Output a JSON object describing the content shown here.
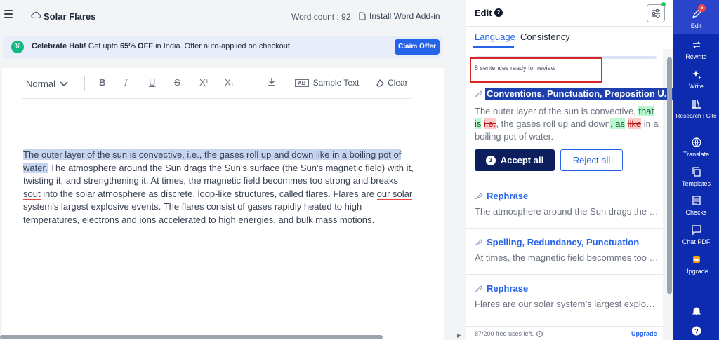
{
  "header": {
    "doc_title": "Solar Flares",
    "word_count": "Word count : 92",
    "install_addin": "Install Word Add-in"
  },
  "promo": {
    "lead": "Celebrate Holi!",
    "text_before": " Get upto ",
    "discount": "65% OFF",
    "text_after": " in India. Offer auto-applied on checkout.",
    "button": "Claim Offer"
  },
  "toolbar": {
    "style_select": "Normal",
    "bold": "B",
    "italic": "I",
    "underline": "U",
    "strike": "S",
    "superscript": "X¹",
    "subscript": "X₁",
    "sample_text": "Sample Text",
    "sample_badge": "AB",
    "clear": "Clear"
  },
  "document": {
    "sentence1": "The outer layer of the sun is convective, i.e., the gases roll up and down like in a boiling pot of water.",
    "p_a": " The atmosphere around the Sun drags the Sun’s surface (the Sun’s magnetic field) with it, twisting ",
    "p_b": "it,",
    "p_c": " and strengthening it. At times, the magnetic field becommes too strong and breaks ",
    "p_d": "sout",
    "p_e": " into the solar atmosphere as discrete, loop-like structures, called flares. Flares are ",
    "p_f": "our solar system’s largest explosive events",
    "p_g": ". The flares consist of gases rapidly heated to high temperatures, electrons and ions accelerated to high energies, and bulk mass motions."
  },
  "panel": {
    "title": "Edit",
    "tabs": [
      "Language",
      "Consistency"
    ],
    "review_status": "5 sentences ready for review",
    "cards": [
      {
        "title": "Conventions, Punctuation, Preposition U...",
        "t1": "The outer layer of the sun is convective, ",
        "t2": "that",
        "t3": "is",
        "t4": " ",
        "t5": "i.e.",
        "t6": ", the gases roll up and down",
        "t7": ", as",
        "t8": " ",
        "t9": "like",
        "t10": " in a",
        "t11": "boiling pot of water."
      },
      {
        "title": "Rephrase",
        "text": "The atmosphere around the Sun drags the Su..."
      },
      {
        "title": "Spelling, Redundancy, Punctuation",
        "text": "At times, the magnetic field becommes too s..."
      },
      {
        "title": "Rephrase",
        "text": "Flares are our solar system’s largest explosiv..."
      }
    ],
    "accept_count": "3",
    "accept_all": "Accept all",
    "reject_all": "Reject all",
    "uses_left": "87/200 free uses left.",
    "upgrade": "Upgrade"
  },
  "sidebar": {
    "badge": "5",
    "items": [
      "Edit",
      "Rewrite",
      "Write",
      "Research | Cite",
      "Translate",
      "Templates",
      "Checks",
      "Chat PDF",
      "Upgrade"
    ]
  },
  "colors": {
    "accent": "#2563eb",
    "sidebar": "#0c2bae",
    "accept_button": "#0c1f5c",
    "highlight": "#c7d4f0"
  }
}
